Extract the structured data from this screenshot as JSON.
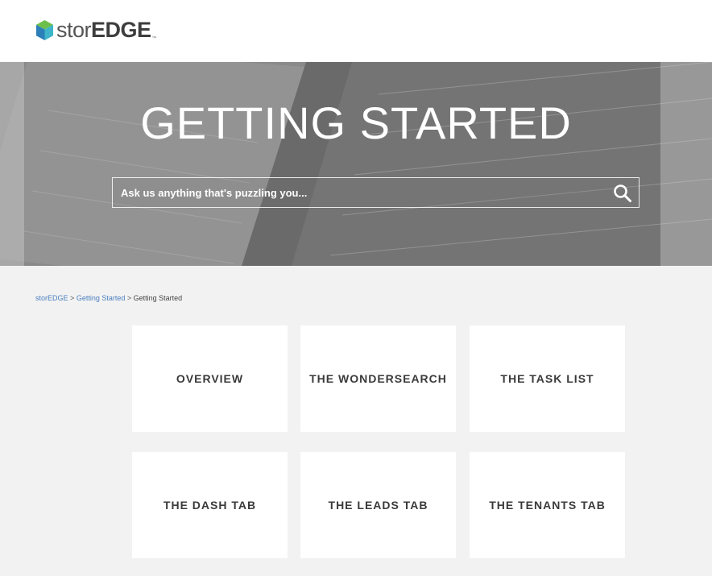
{
  "header": {
    "logo_light": "stor",
    "logo_bold": "EDGE",
    "logo_tm": "™",
    "colors": {
      "cube_top": "#6cc04a",
      "cube_left": "#2c7fb8",
      "cube_right": "#3fb5c9"
    }
  },
  "hero": {
    "title": "GETTING STARTED",
    "search_placeholder": "Ask us anything that's puzzling you...",
    "search_icon": "search-icon"
  },
  "breadcrumb": {
    "items": [
      "storEDGE",
      "Getting Started"
    ],
    "separator": ">",
    "current": "Getting Started"
  },
  "tiles": [
    {
      "label": "OVERVIEW"
    },
    {
      "label": "THE WONDERSEARCH"
    },
    {
      "label": "THE TASK LIST"
    },
    {
      "label": "THE DASH TAB"
    },
    {
      "label": "THE LEADS TAB"
    },
    {
      "label": "THE TENANTS TAB"
    }
  ],
  "colors": {
    "page_bg": "#f2f2f2",
    "link": "#4a7fbf",
    "tile_text": "#3a3a3a"
  }
}
